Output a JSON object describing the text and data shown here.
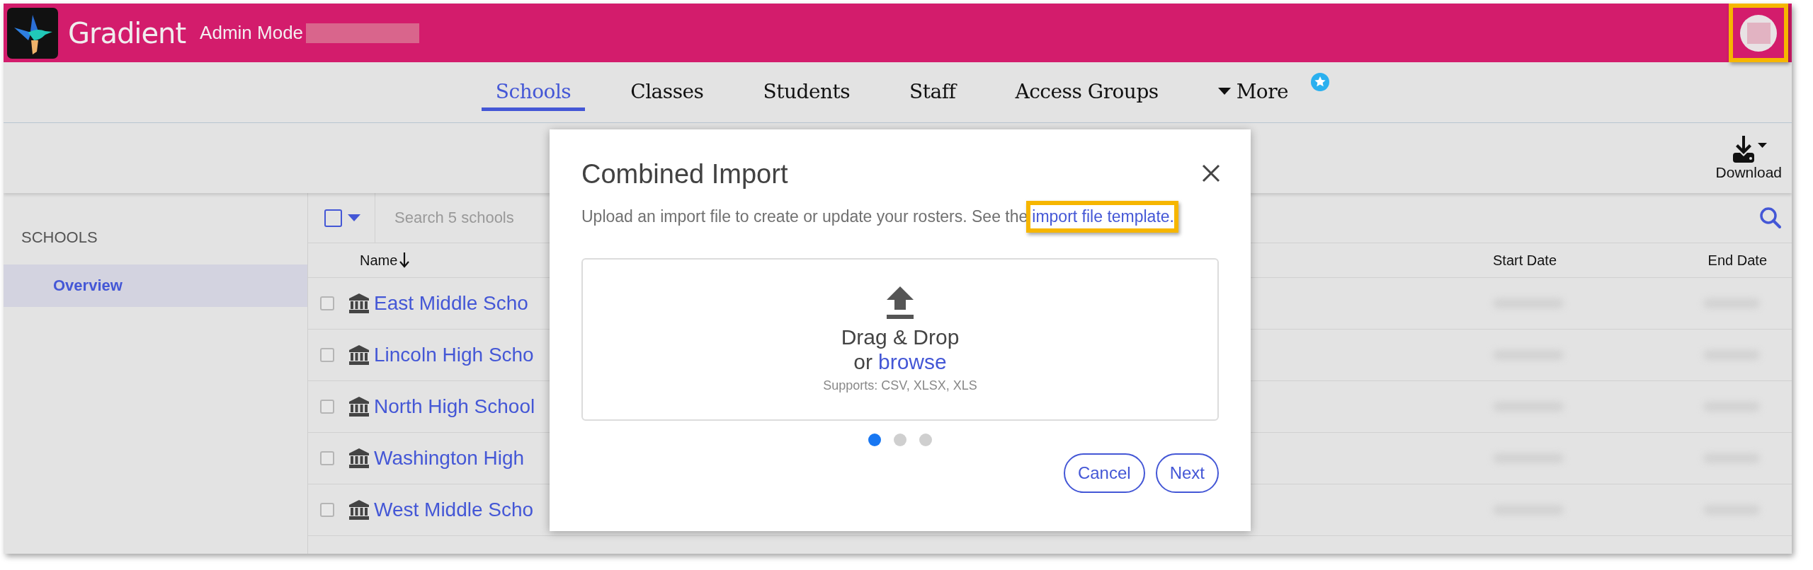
{
  "header": {
    "brand": "Gradient",
    "mode": "Admin Mode",
    "avatar_highlighted": true
  },
  "nav": {
    "tabs": [
      {
        "label": "Schools",
        "selected": true,
        "kind": "tab"
      },
      {
        "label": "Classes",
        "selected": false,
        "kind": "tab"
      },
      {
        "label": "Students",
        "selected": false,
        "kind": "tab"
      },
      {
        "label": "Staff",
        "selected": false,
        "kind": "tab"
      },
      {
        "label": "Access Groups",
        "selected": false,
        "kind": "tab"
      },
      {
        "label": "More",
        "selected": false,
        "kind": "dropdown"
      }
    ]
  },
  "toolbar": {
    "download": "Download"
  },
  "sidebar": {
    "heading": "SCHOOLS",
    "items": [
      {
        "label": "Overview",
        "selected": true
      }
    ]
  },
  "table": {
    "search_placeholder": "Search 5 schools",
    "select_all_checked": false,
    "columns": [
      "Name",
      "Start Date",
      "End Date"
    ],
    "rows": [
      {
        "name": "East Middle Scho",
        "checked": false
      },
      {
        "name": "Lincoln High Scho",
        "checked": false
      },
      {
        "name": "North High School",
        "checked": false
      },
      {
        "name": "Washington High",
        "checked": false
      },
      {
        "name": "West Middle Scho",
        "checked": false
      }
    ]
  },
  "dialog": {
    "title": "Combined Import",
    "description": "Upload an import file to create or update your rosters. See the",
    "link": "import file template",
    "link_suffix": ".",
    "link_highlighted": true,
    "dropzone": {
      "title": "Drag & Drop",
      "or": "or",
      "browse": "browse",
      "supports": "Supports: CSV, XLSX, XLS"
    },
    "steps": [
      {
        "selected": true
      },
      {
        "selected": false
      },
      {
        "selected": false
      }
    ],
    "buttons": [
      "Cancel",
      "Next"
    ]
  }
}
